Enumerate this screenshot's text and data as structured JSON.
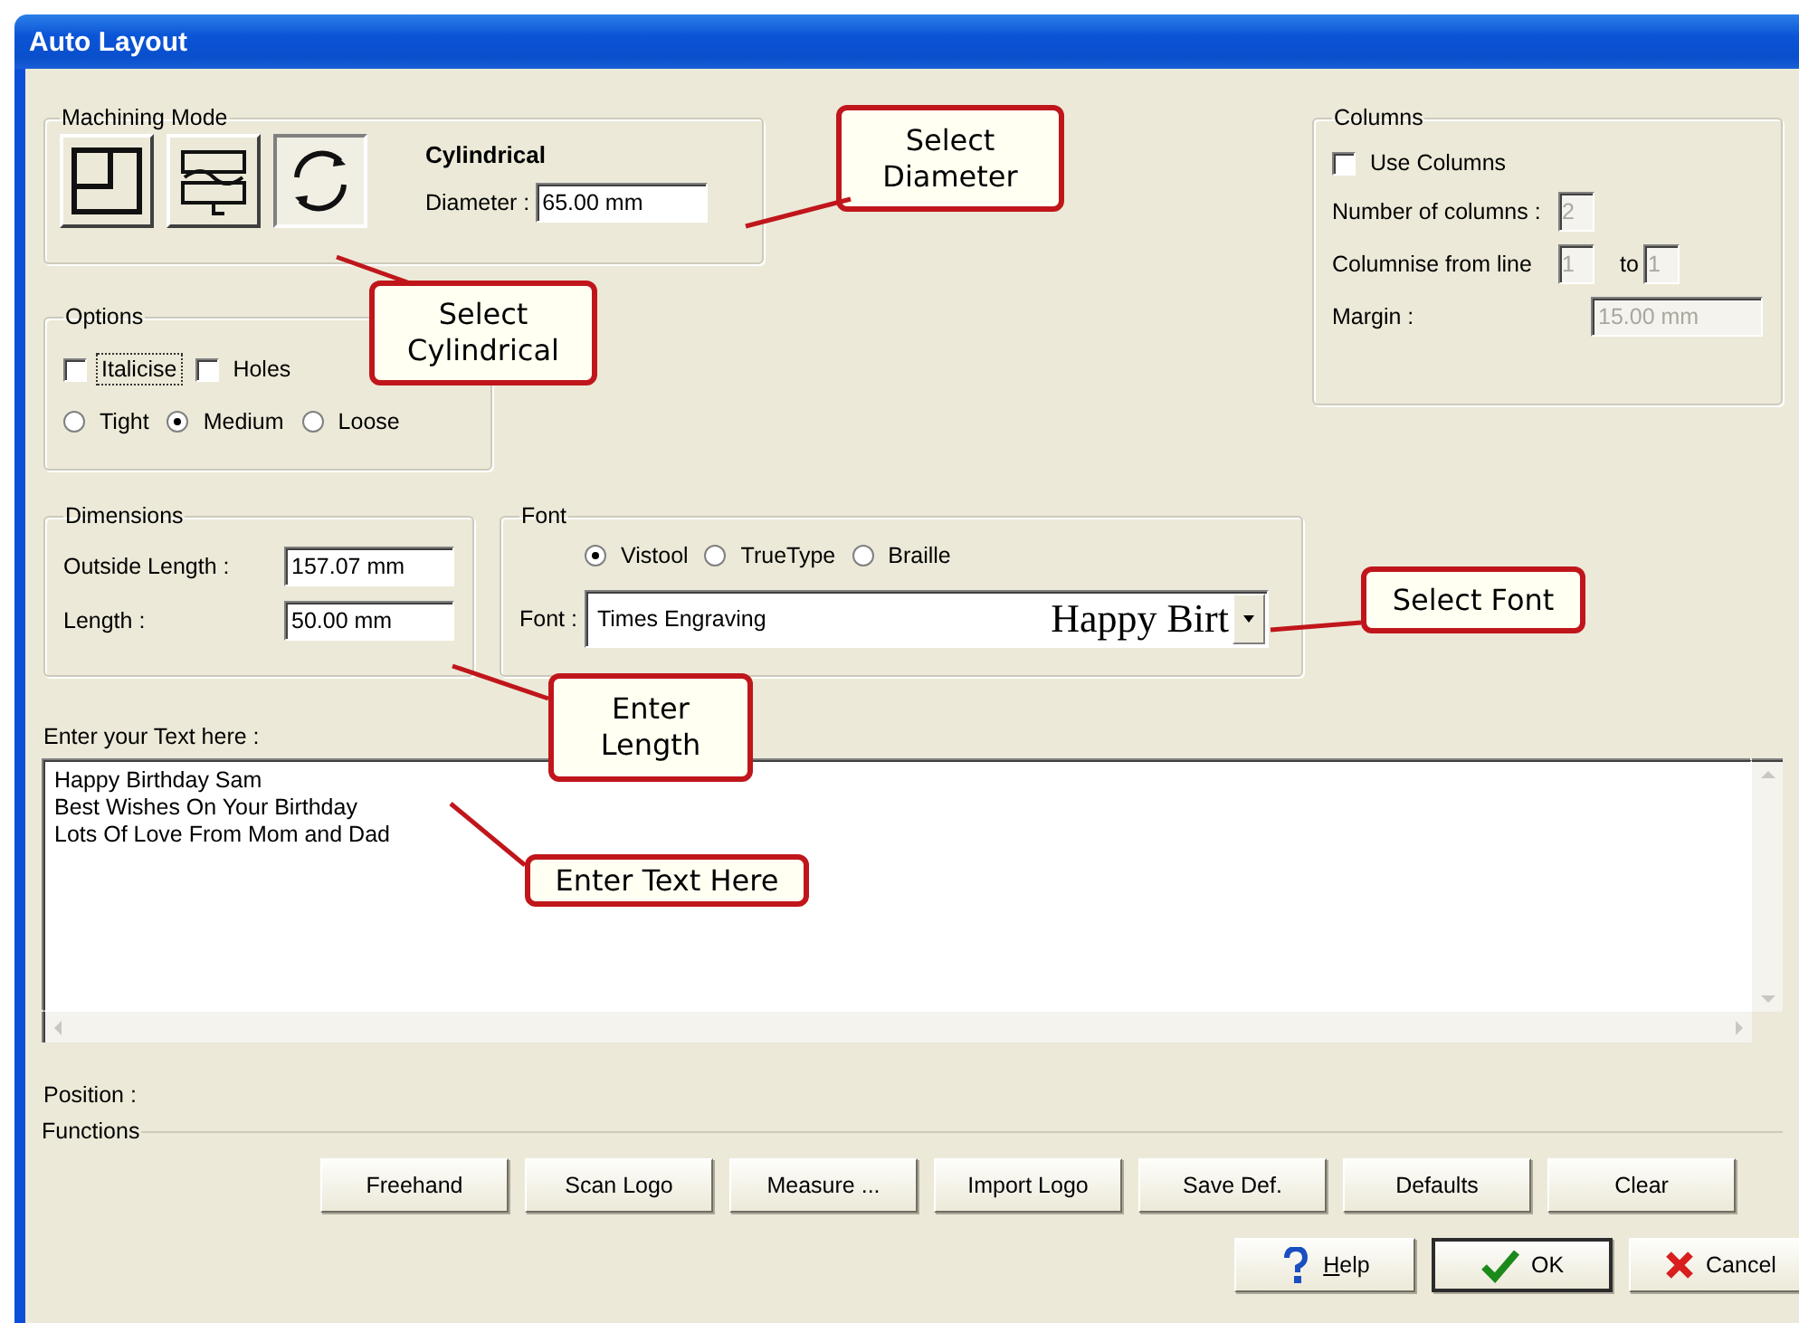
{
  "window": {
    "title": "Auto Layout"
  },
  "machining_mode": {
    "label": "Machining Mode",
    "modes": [
      {
        "kind": "flat",
        "selected": false
      },
      {
        "kind": "plates",
        "selected": false
      },
      {
        "kind": "cylindrical",
        "selected": true
      }
    ],
    "mode_name": "Cylindrical",
    "diameter": {
      "label": "Diameter :",
      "value": "65.00 mm"
    }
  },
  "options": {
    "label": "Options",
    "checkboxes": [
      {
        "label": "Italicise",
        "checked": false,
        "focused": true
      },
      {
        "label": "Holes",
        "checked": false,
        "focused": false
      }
    ],
    "spacing": [
      {
        "label": "Tight",
        "selected": false
      },
      {
        "label": "Medium",
        "selected": true
      },
      {
        "label": "Loose",
        "selected": false
      }
    ]
  },
  "columns": {
    "label": "Columns",
    "use_columns": {
      "label": "Use Columns",
      "checked": false
    },
    "number_of_columns": {
      "label": "Number of columns :",
      "value": "2",
      "disabled": true
    },
    "columnise": {
      "label": "Columnise from line",
      "from": "1",
      "to_label": "to",
      "to": "1",
      "disabled": true
    },
    "margin": {
      "label": "Margin :",
      "value": "15.00 mm",
      "disabled": true
    }
  },
  "dimensions": {
    "label": "Dimensions",
    "fields": [
      {
        "label": "Outside Length :",
        "value": "157.07 mm"
      },
      {
        "label": "Length :",
        "value": "50.00 mm"
      }
    ]
  },
  "font": {
    "label": "Font",
    "types": [
      {
        "label": "Vistool",
        "selected": true
      },
      {
        "label": "TrueType",
        "selected": false
      },
      {
        "label": "Braille",
        "selected": false
      }
    ],
    "font_label": "Font :",
    "font_name": "Times Engraving",
    "preview": "Happy Birt"
  },
  "text_entry": {
    "label": "Enter your Text here :",
    "lines": [
      "Happy Birthday Sam",
      "Best Wishes On Your Birthday",
      "Lots Of Love From Mom and Dad"
    ]
  },
  "position": {
    "label": "Position :"
  },
  "functions": {
    "label": "Functions",
    "buttons": [
      "Freehand",
      "Scan Logo",
      "Measure ...",
      "Import Logo",
      "Save Def.",
      "Defaults",
      "Clear"
    ]
  },
  "dialog_buttons": [
    {
      "kind": "help",
      "label": "Help"
    },
    {
      "kind": "ok",
      "label": "OK"
    },
    {
      "kind": "cancel",
      "label": "Cancel"
    }
  ],
  "callouts": [
    {
      "text": "Select Diameter"
    },
    {
      "text": "Select Cylindrical"
    },
    {
      "text": "Select Font"
    },
    {
      "text": "Enter Length"
    },
    {
      "text": "Enter Text Here"
    }
  ]
}
